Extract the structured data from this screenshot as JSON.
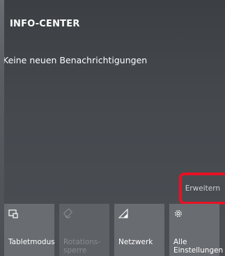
{
  "info_center": {
    "title": "INFO-CENTER",
    "empty_message": "Keine neuen Benachrichtigungen",
    "expand_label": "Erweitern"
  },
  "quick_actions": [
    {
      "label": "Tabletmodus",
      "icon": "tablet-mode-icon",
      "enabled": true
    },
    {
      "label": "Rotations-\nsperre",
      "icon": "rotation-lock-icon",
      "enabled": false
    },
    {
      "label": "Netzwerk",
      "icon": "network-icon",
      "enabled": true
    },
    {
      "label": "Alle\nEinstellungen",
      "icon": "settings-gear-icon",
      "enabled": true
    }
  ],
  "colors": {
    "highlight": "#e81123",
    "tile": "#696c70",
    "panel": "#45494e"
  }
}
